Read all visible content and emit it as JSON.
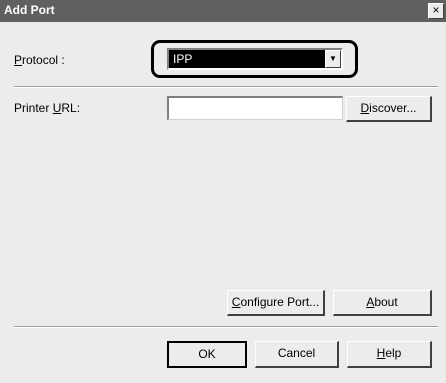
{
  "window": {
    "title": "Add Port",
    "close_glyph": "×"
  },
  "form": {
    "protocol_label_pre": "P",
    "protocol_label_rest": "rotocol :",
    "protocol_value": "IPP",
    "printer_url_label_pre": "Printer ",
    "printer_url_label_u": "U",
    "printer_url_label_rest": "RL:",
    "printer_url_value": ""
  },
  "buttons": {
    "discover_u": "D",
    "discover_rest": "iscover...",
    "configure_u": "C",
    "configure_rest": "onfigure Port...",
    "about_u": "A",
    "about_rest": "bout",
    "ok": "OK",
    "cancel": "Cancel",
    "help_u": "H",
    "help_rest": "elp"
  },
  "icons": {
    "dropdown": "chevron-down-icon",
    "close": "close-icon"
  }
}
